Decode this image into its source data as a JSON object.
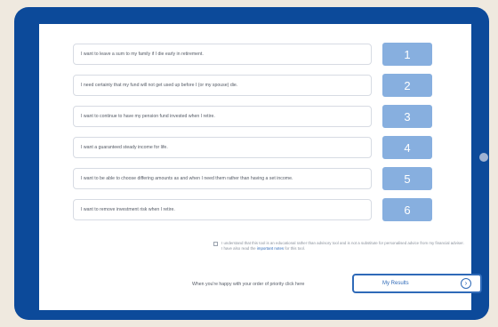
{
  "statements": [
    {
      "text": "I want to leave a sum to my family if I die early in retirement.",
      "number": "1"
    },
    {
      "text": "I need certainty that my fund will not get used up before I (or my spouse) die.",
      "number": "2"
    },
    {
      "text": "I want to continue to have my pension fund invested when I retire.",
      "number": "3"
    },
    {
      "text": "I want a guaranteed steady income for life.",
      "number": "4"
    },
    {
      "text": "I want to be able to choose differing amounts as and when I need them rather than having a set income.",
      "number": "5"
    },
    {
      "text": "I want to remove investment risk when I retire.",
      "number": "6"
    }
  ],
  "consent": {
    "text": "I understand that this tool is an educational rather than advisory tool and is not a substitute for personalised advice from my financial adviser. I have also read the",
    "link": "important notes",
    "suffix": "for this tool."
  },
  "footer": {
    "label": "When you're happy with your order of priority click here",
    "button_label": "My Results"
  },
  "colors": {
    "frame": "#0c4a9a",
    "number_box": "#87afdf",
    "accent": "#2f6ab8"
  },
  "icons": {
    "results_button": "chevron-right-circle-icon"
  }
}
